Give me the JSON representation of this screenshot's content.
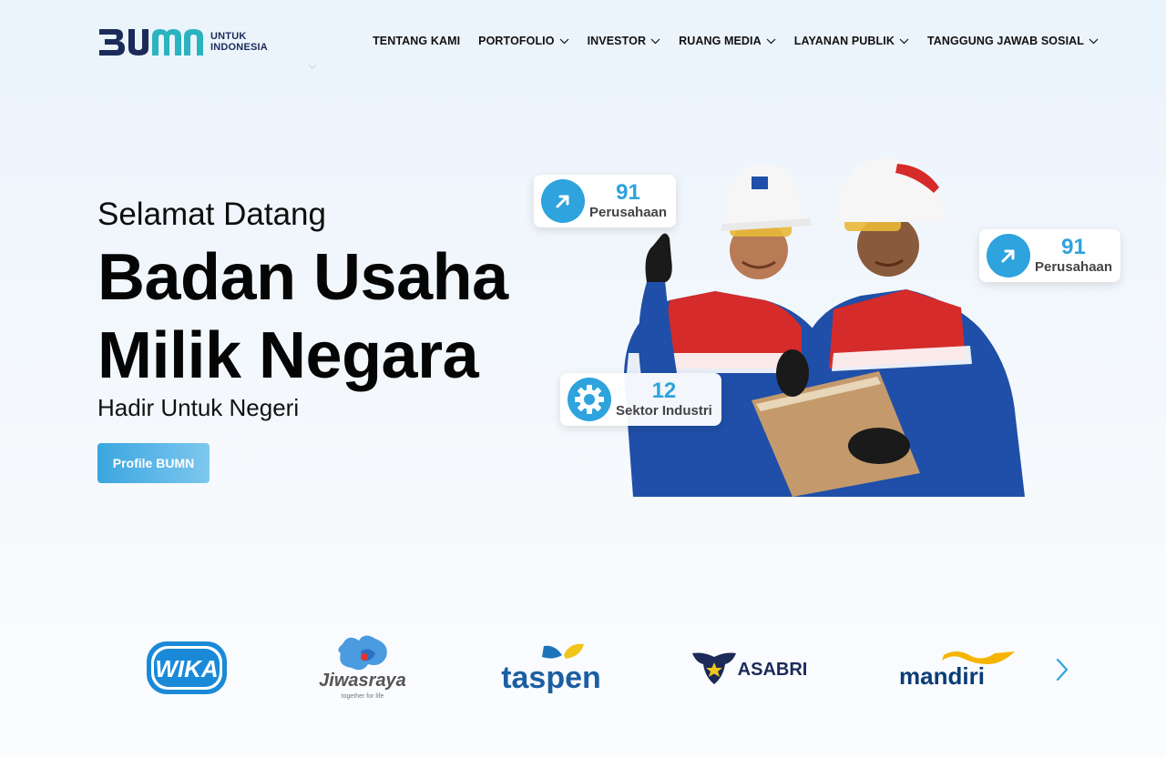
{
  "brand": {
    "logo_text": "BUMN",
    "logo_sub_line1": "UNTUK",
    "logo_sub_line2": "INDONESIA"
  },
  "nav": {
    "items": [
      {
        "label": "TENTANG KAMI",
        "dropdown": false
      },
      {
        "label": "PORTOFOLIO",
        "dropdown": true
      },
      {
        "label": "INVESTOR",
        "dropdown": true
      },
      {
        "label": "RUANG MEDIA",
        "dropdown": true
      },
      {
        "label": "LAYANAN PUBLIK",
        "dropdown": true
      },
      {
        "label": "TANGGUNG JAWAB SOSIAL",
        "dropdown": true
      }
    ]
  },
  "hero": {
    "greeting": "Selamat Datang",
    "headline_line1": "Badan Usaha",
    "headline_line2": "Milik Negara",
    "tagline": "Hadir Untuk Negeri",
    "cta_label": "Profile BUMN"
  },
  "stats": [
    {
      "number": "91",
      "label": "Perusahaan",
      "icon": "arrow-up-right-icon"
    },
    {
      "number": "91",
      "label": "Perusahaan",
      "icon": "arrow-up-right-icon"
    },
    {
      "number": "12",
      "label": "Sektor Industri",
      "icon": "gear-icon"
    }
  ],
  "partners": [
    {
      "name": "WIKA",
      "text": "WIKA"
    },
    {
      "name": "Jiwasraya",
      "text": "Jiwasraya",
      "sub": "together for life"
    },
    {
      "name": "Taspen",
      "text": "taspen"
    },
    {
      "name": "ASABRI",
      "text": "ASABRI"
    },
    {
      "name": "Mandiri",
      "text": "mandiri"
    }
  ],
  "colors": {
    "accent": "#2ea3dd",
    "brand_navy": "#1c2a5a",
    "brand_teal": "#2bb3c0"
  }
}
